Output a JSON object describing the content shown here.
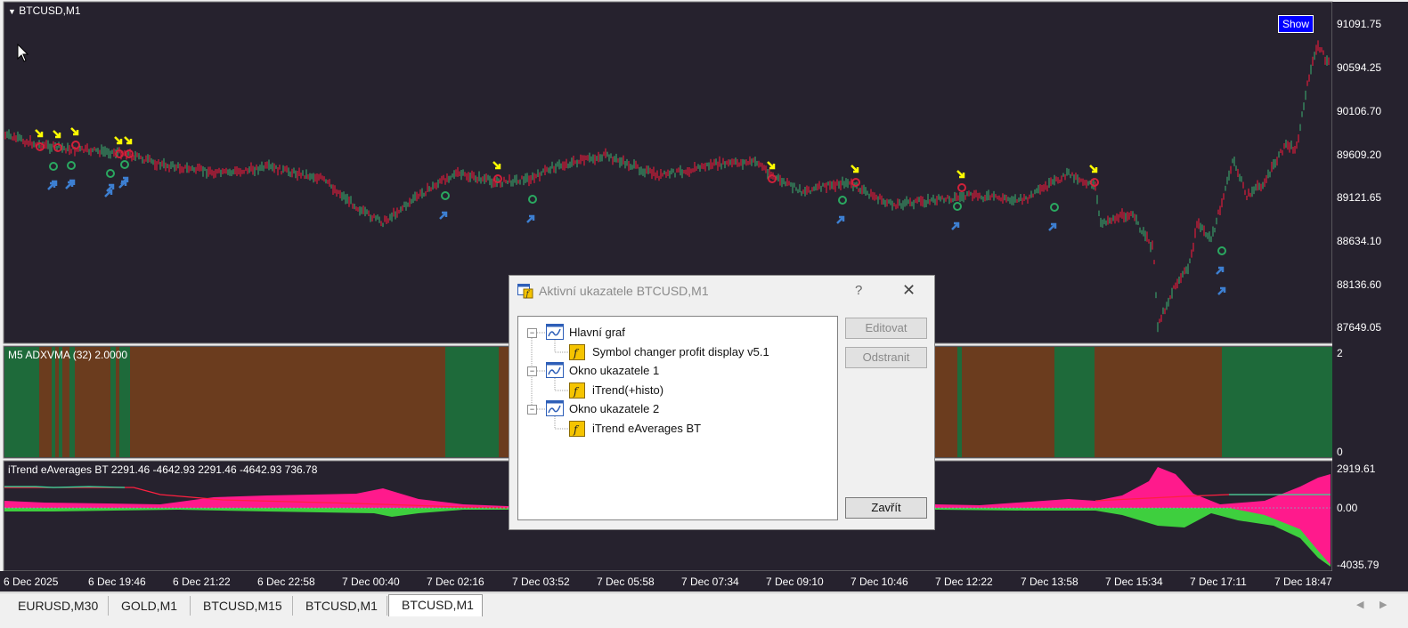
{
  "window": {
    "symbol_title": "BTCUSD,M1",
    "show_button": "Show"
  },
  "price_axis": [
    "91091.75",
    "90594.25",
    "90106.70",
    "89609.20",
    "89121.65",
    "88634.10",
    "88136.60",
    "87649.05"
  ],
  "indicator1": {
    "label": "M5 ADXVMA (32) 2.0000",
    "axis_top": "2",
    "axis_bottom": "0",
    "colors": {
      "bull": "#1e6a3a",
      "bear": "#6b3c1e"
    }
  },
  "indicator2": {
    "label": "iTrend eAverages BT 2291.46 -4642.93 2291.46 -4642.93 736.78",
    "axis_top": "2919.61",
    "axis_mid": "0.00",
    "axis_bottom": "-4035.79"
  },
  "time_axis": [
    "6 Dec 2025",
    "6 Dec 19:46",
    "6 Dec 21:22",
    "6 Dec 22:58",
    "7 Dec 00:40",
    "7 Dec 02:16",
    "7 Dec 03:52",
    "7 Dec 05:58",
    "7 Dec 07:34",
    "7 Dec 09:10",
    "7 Dec 10:46",
    "7 Dec 12:22",
    "7 Dec 13:58",
    "7 Dec 15:34",
    "7 Dec 17:11",
    "7 Dec 18:47"
  ],
  "tabs": [
    {
      "label": "EURUSD,M30",
      "active": false
    },
    {
      "label": "GOLD,M1",
      "active": false
    },
    {
      "label": "BTCUSD,M15",
      "active": false
    },
    {
      "label": "BTCUSD,M1",
      "active": false
    },
    {
      "label": "BTCUSD,M1",
      "active": true
    }
  ],
  "dialog": {
    "title": "Aktivní ukazatele BTCUSD,M1",
    "help": "?",
    "tree": [
      {
        "label": "Hlavní graf",
        "level": 0
      },
      {
        "label": "Symbol changer profit display v5.1",
        "level": 1
      },
      {
        "label": "Okno ukazatele 1",
        "level": 0
      },
      {
        "label": "iTrend(+histo)",
        "level": 1
      },
      {
        "label": "Okno ukazatele 2",
        "level": 0
      },
      {
        "label": "iTrend eAverages BT",
        "level": 1
      }
    ],
    "buttons": {
      "edit": "Editovat",
      "remove": "Odstranit",
      "close": "Zavřít"
    }
  },
  "colors": {
    "chart_bg": "#26222e",
    "candle_up": "#3cb371",
    "candle_down": "#ff1a3c",
    "sell_arrow": "#ffff00",
    "buy_arrow": "#3d7fd1",
    "hist_pos": "#ff1a8c",
    "hist_neg": "#3ecf3e"
  }
}
